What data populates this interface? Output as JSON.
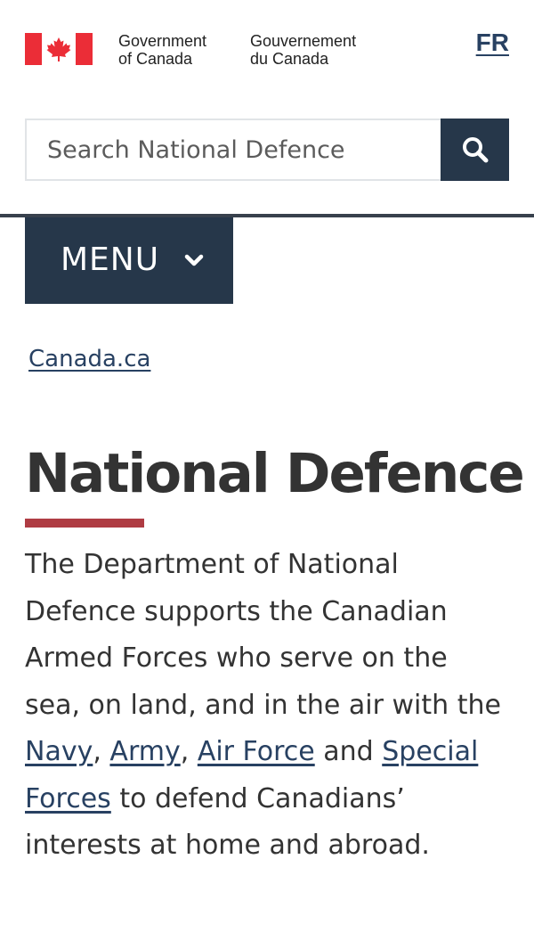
{
  "header": {
    "gov_en_line1": "Government",
    "gov_en_line2": "of Canada",
    "gov_fr_line1": "Gouvernement",
    "gov_fr_line2": "du Canada",
    "language_link": "FR"
  },
  "search": {
    "placeholder": "Search National Defence",
    "value": "",
    "button_icon": "search-icon"
  },
  "menu": {
    "label": "MENU",
    "icon": "chevron-down-icon"
  },
  "breadcrumb": {
    "items": [
      "Canada.ca"
    ]
  },
  "main": {
    "title": "National Defence",
    "intro": {
      "part1": "The Department of National Defence supports the Canadian Armed Forces who serve on the sea, on land, and in the air with the ",
      "link_navy": "Navy",
      "sep1": ", ",
      "link_army": "Army",
      "sep2": ", ",
      "link_air_force": "Air Force",
      "part2": " and ",
      "link_special_forces": "Special Forces",
      "part3": " to defend Canadians’ interests at home and abroad."
    }
  },
  "colors": {
    "brand_dark": "#26374a",
    "link": "#284162",
    "accent_red": "#af3c43",
    "flag_red": "#eb2d37",
    "text": "#333333"
  }
}
